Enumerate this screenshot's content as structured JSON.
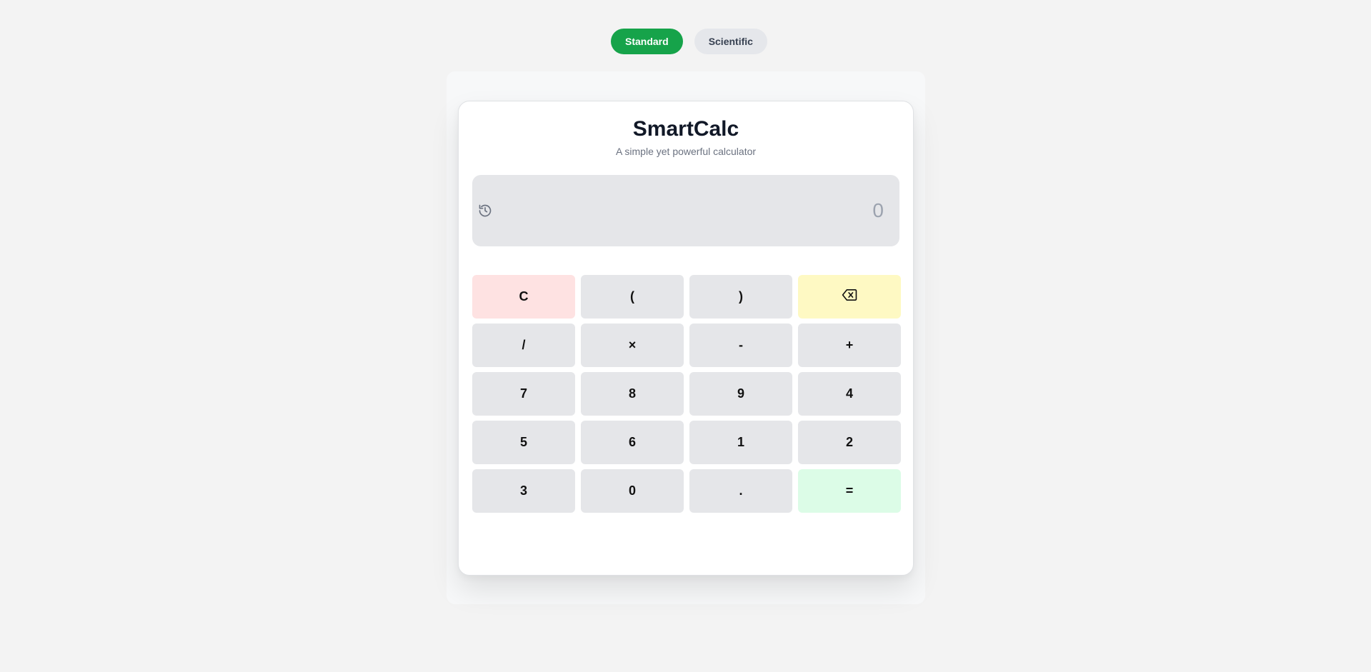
{
  "modes": {
    "standard_label": "Standard",
    "scientific_label": "Scientific",
    "active": "Standard"
  },
  "app": {
    "title": "SmartCalc",
    "subtitle": "A simple yet powerful calculator"
  },
  "display": {
    "value": "0",
    "history_icon": "history-icon"
  },
  "keys": [
    {
      "label": "C",
      "name": "clear-button"
    },
    {
      "label": "(",
      "name": "open-paren-button"
    },
    {
      "label": ")",
      "name": "close-paren-button"
    },
    {
      "label": "",
      "name": "backspace-button",
      "icon": "backspace-icon"
    },
    {
      "label": "/",
      "name": "divide-button"
    },
    {
      "label": "×",
      "name": "multiply-button"
    },
    {
      "label": "-",
      "name": "subtract-button"
    },
    {
      "label": "+",
      "name": "add-button"
    },
    {
      "label": "7",
      "name": "digit-7-button"
    },
    {
      "label": "8",
      "name": "digit-8-button"
    },
    {
      "label": "9",
      "name": "digit-9-button"
    },
    {
      "label": "4",
      "name": "digit-4-button"
    },
    {
      "label": "5",
      "name": "digit-5-button"
    },
    {
      "label": "6",
      "name": "digit-6-button"
    },
    {
      "label": "1",
      "name": "digit-1-button"
    },
    {
      "label": "2",
      "name": "digit-2-button"
    },
    {
      "label": "3",
      "name": "digit-3-button"
    },
    {
      "label": "0",
      "name": "digit-0-button"
    },
    {
      "label": ".",
      "name": "decimal-button"
    },
    {
      "label": "=",
      "name": "equals-button"
    }
  ],
  "colors": {
    "accent": "#16a34a",
    "clear_key": "#fee2e2",
    "backspace_key": "#fef9c3",
    "equals_key": "#dcfce7",
    "key": "#e5e6e9"
  }
}
